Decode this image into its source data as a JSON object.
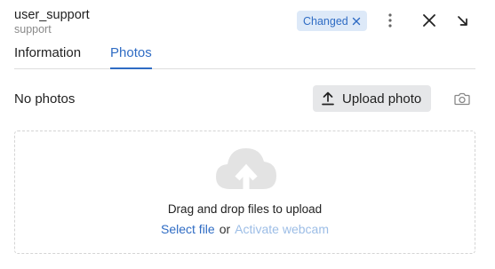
{
  "header": {
    "title": "user_support",
    "subtitle": "support",
    "badge_label": "Changed"
  },
  "icons": {
    "badge_close": "close-icon",
    "more": "more-vertical-icon",
    "close": "close-icon",
    "collapse": "arrow-down-right-icon",
    "upload": "upload-icon",
    "camera": "camera-icon",
    "cloud": "cloud-upload-icon"
  },
  "colors": {
    "accent": "#2f6cc4",
    "badge_bg": "#dde9f8",
    "button_bg": "#e6e7e9",
    "disabled_link": "#9cbde6"
  },
  "tabs": [
    {
      "label": "Information",
      "active": false
    },
    {
      "label": "Photos",
      "active": true
    }
  ],
  "photos": {
    "empty_text": "No photos",
    "upload_label": "Upload photo",
    "dropzone": {
      "instruction": "Drag and drop files to upload",
      "select_label": "Select file",
      "or_label": "or",
      "webcam_label": "Activate webcam"
    }
  }
}
